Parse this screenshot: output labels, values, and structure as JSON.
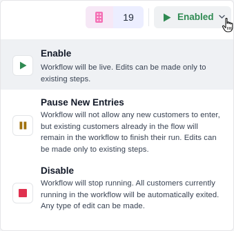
{
  "toolbar": {
    "count_icon": "grid-dots-icon",
    "count": "19",
    "status_label": "Enabled",
    "status_icon": "play-icon",
    "chevron_icon": "chevron-down-icon"
  },
  "menu": {
    "items": [
      {
        "title": "Enable",
        "description": "Workflow will be live. Edits can be made only to existing steps.",
        "icon": "play-icon",
        "icon_color": "#2f8a52",
        "selected": true
      },
      {
        "title": "Pause New Entries",
        "description": "Workflow will not allow any new customers to enter, but existing customers already in the flow will remain in the workflow to finish their run. Edits can be made only to existing steps.",
        "icon": "pause-icon",
        "icon_color": "#a0700d"
      },
      {
        "title": "Disable",
        "description": "Workflow will stop running. All customers currently running in the workflow will be automatically exited. Any type of edit can be made.",
        "icon": "stop-icon",
        "icon_color": "#e0314f"
      }
    ]
  },
  "colors": {
    "accent_green": "#2f8a52",
    "count_chip_bg": "#eceeff",
    "count_icon_color": "#d946a8"
  }
}
